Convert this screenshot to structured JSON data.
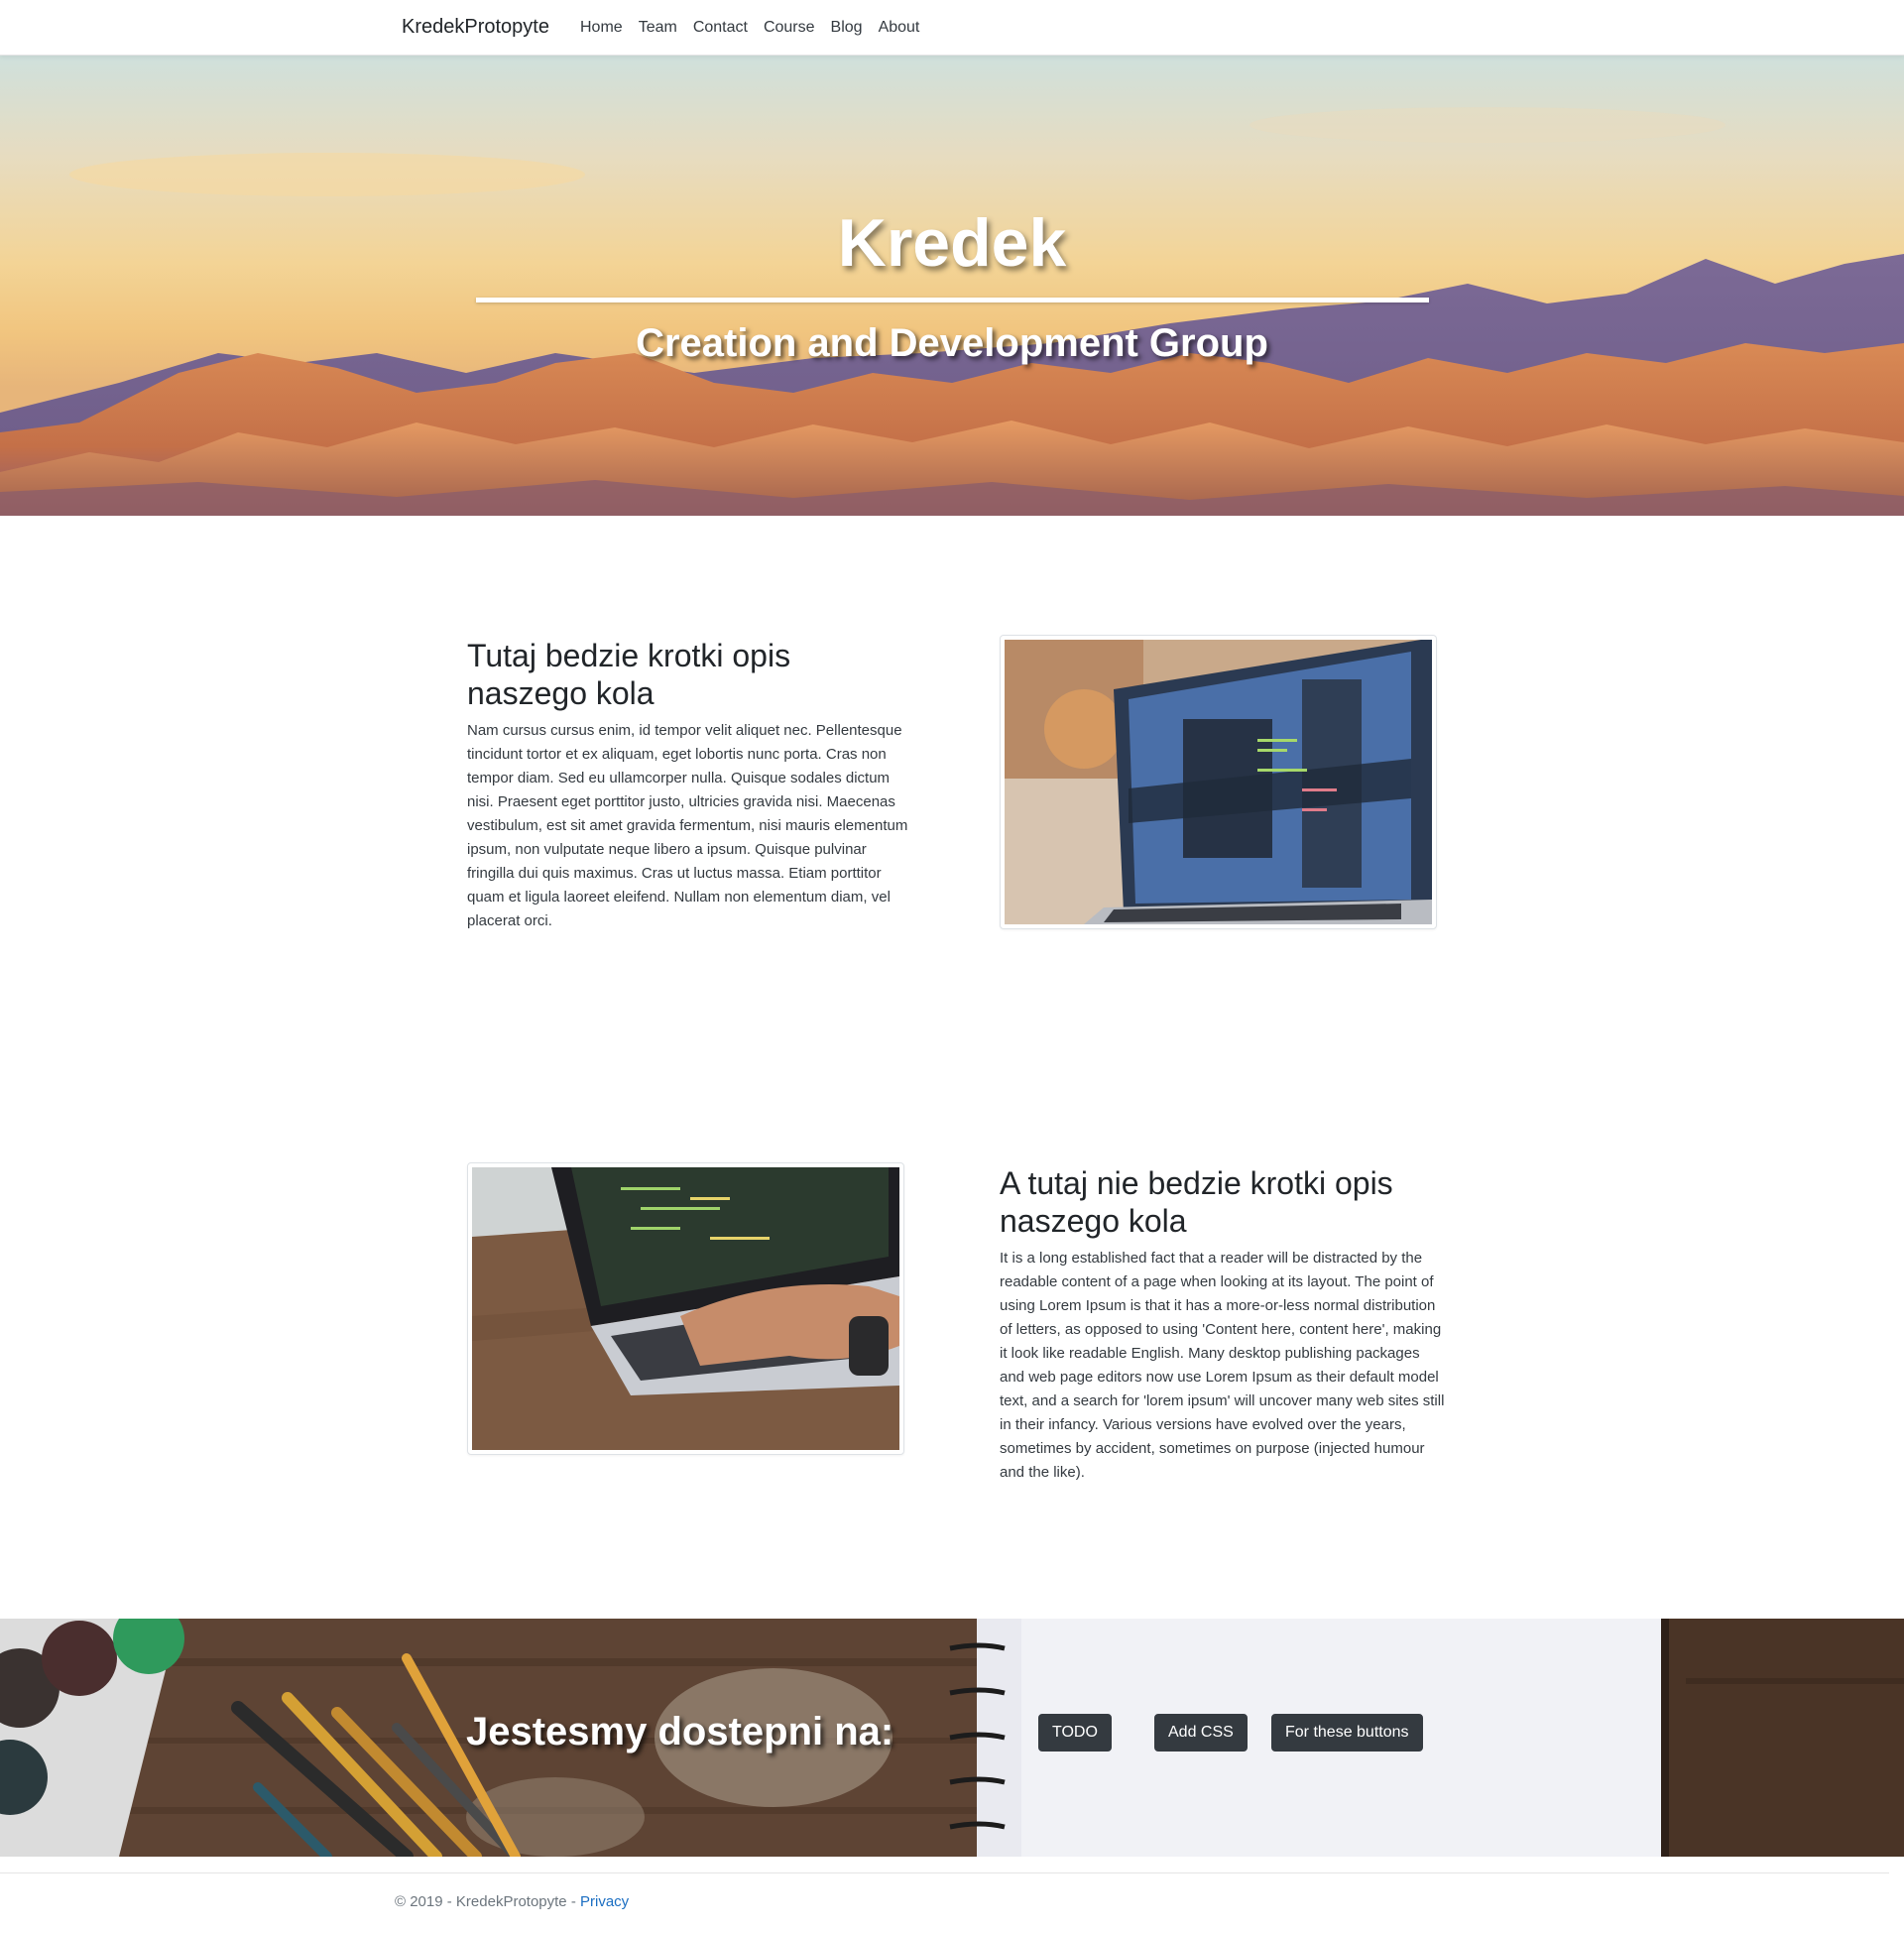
{
  "navbar": {
    "brand": "KredekProtopyte",
    "items": [
      "Home",
      "Team",
      "Contact",
      "Course",
      "Blog",
      "About"
    ]
  },
  "hero": {
    "title": "Kredek",
    "subtitle": "Creation and Development Group"
  },
  "section1": {
    "title": "Tutaj bedzie krotki opis naszego kola",
    "text": "Nam cursus cursus enim, id tempor velit aliquet nec. Pellentesque tincidunt tortor et ex aliquam, eget lobortis nunc porta. Cras non tempor diam. Sed eu ullamcorper nulla. Quisque sodales dictum nisi. Praesent eget porttitor justo, ultricies gravida nisi. Maecenas vestibulum, est sit amet gravida fermentum, nisi mauris elementum ipsum, non vulputate neque libero a ipsum. Quisque pulvinar fringilla dui quis maximus. Cras ut luctus massa. Etiam porttitor quam et ligula laoreet eleifend. Nullam non elementum diam, vel placerat orci."
  },
  "section2": {
    "title": "A tutaj nie bedzie krotki opis naszego kola",
    "text": "It is a long established fact that a reader will be distracted by the readable content of a page when looking at its layout. The point of using Lorem Ipsum is that it has a more-or-less normal distribution of letters, as opposed to using 'Content here, content here', making it look like readable English. Many desktop publishing packages and web page editors now use Lorem Ipsum as their default model text, and a search for 'lorem ipsum' will uncover many web sites still in their infancy. Various versions have evolved over the years, sometimes by accident, sometimes on purpose (injected humour and the like)."
  },
  "contact": {
    "title": "Jestesmy dostepni na:",
    "buttons": [
      "TODO",
      "Add CSS",
      "For these buttons"
    ]
  },
  "footer": {
    "copyright": "© 2019 - KredekProtopyte - ",
    "privacy": "Privacy"
  }
}
